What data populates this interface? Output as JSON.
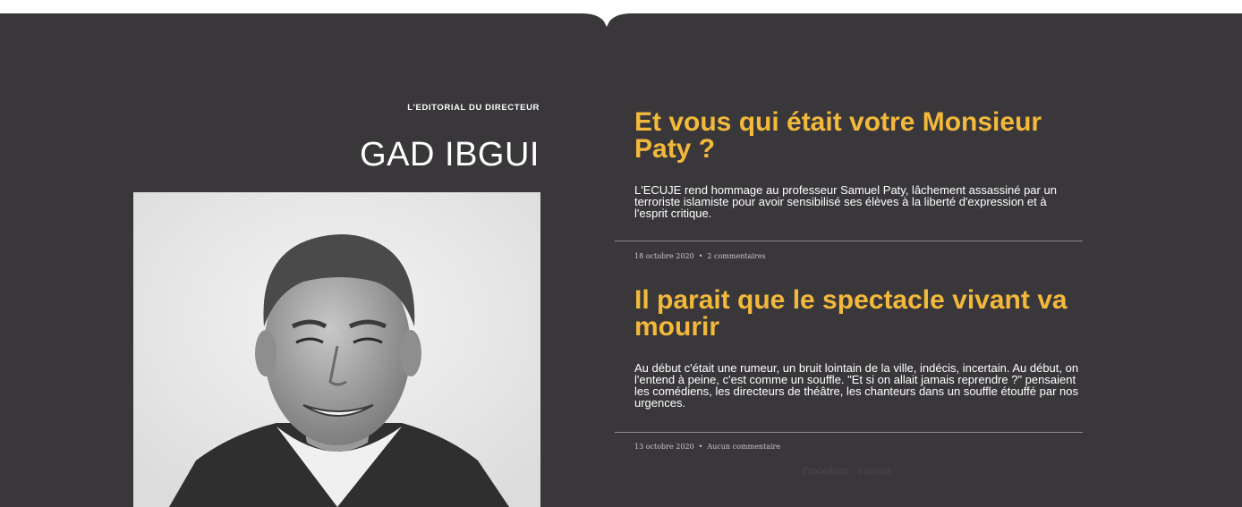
{
  "editorial": {
    "eyebrow": "L'EDITORIAL DU DIRECTEUR",
    "author": "GAD IBGUI"
  },
  "articles": [
    {
      "title": "Et vous qui était votre Monsieur Paty ?",
      "excerpt": "L'ECUJE rend hommage au professeur Samuel Paty, lâchement assassiné par un terroriste islamiste pour avoir sensibilisé ses élèves à la liberté d'expression et à l'esprit critique.",
      "date": "18 octobre 2020",
      "separator": "•",
      "comments": "2 commentaires"
    },
    {
      "title": "Il parait que le spectacle vivant va mourir",
      "excerpt": "Au début c'était une rumeur, un bruit lointain de la ville, indécis, incertain. Au début, on l'entend à peine, c'est comme un souffle. \"Et si on allait jamais reprendre ?\" pensaient les comédiens, les directeurs de théâtre, les chanteurs dans un souffle étouffé par nos urgences.",
      "date": "13 octobre 2020",
      "separator": "•",
      "comments": "Aucun commentaire"
    }
  ],
  "pagination": {
    "prev": "Precedent",
    "next": "Suivant"
  },
  "colors": {
    "panel": "#3a373b",
    "accent": "#f2b93b",
    "text": "#ffffff"
  }
}
